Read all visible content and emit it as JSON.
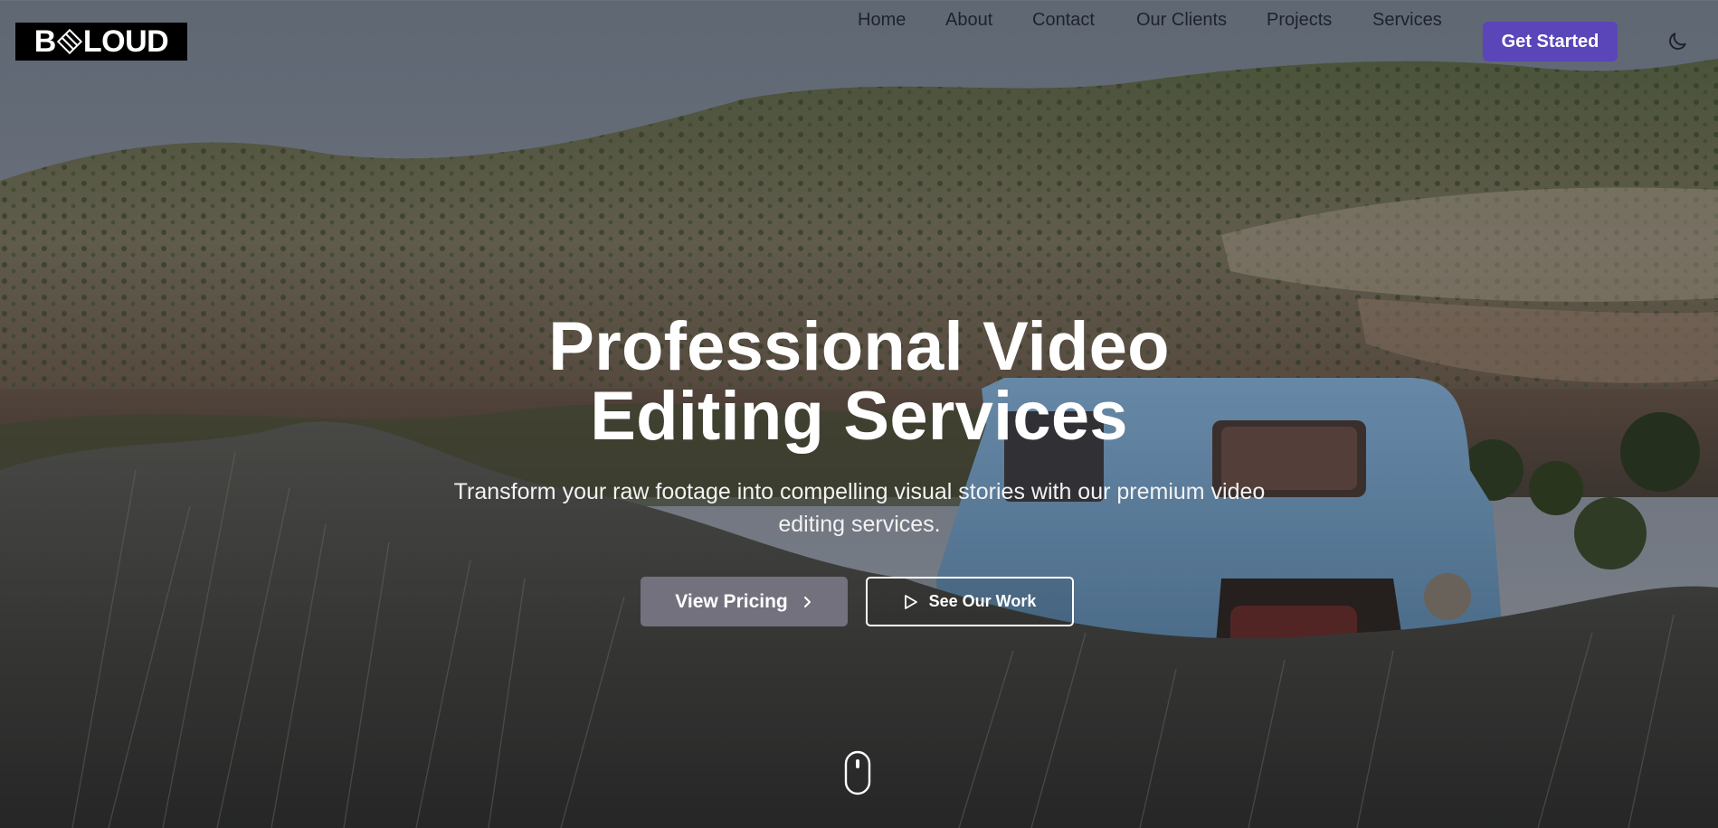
{
  "brand": {
    "logo_text_left": "B",
    "logo_text_right": "LOUD"
  },
  "nav": {
    "items": [
      {
        "label": "Home"
      },
      {
        "label": "About"
      },
      {
        "label": "Contact"
      },
      {
        "label": "Our Clients"
      },
      {
        "label": "Projects"
      },
      {
        "label": "Services"
      }
    ],
    "cta_label": "Get Started",
    "theme_icon": "moon-icon"
  },
  "hero": {
    "title_line1": "Professional Video",
    "title_line2": "Editing Services",
    "subtitle": "Transform your raw footage into compelling visual stories with our premium video editing services.",
    "primary_button": "View Pricing",
    "secondary_button": "See Our Work",
    "scroll_icon": "mouse-scroll-icon"
  },
  "colors": {
    "accent": "#5a46b8",
    "nav_text": "#1e2230",
    "primary_button_bg": "#787684",
    "text": "#ffffff"
  }
}
